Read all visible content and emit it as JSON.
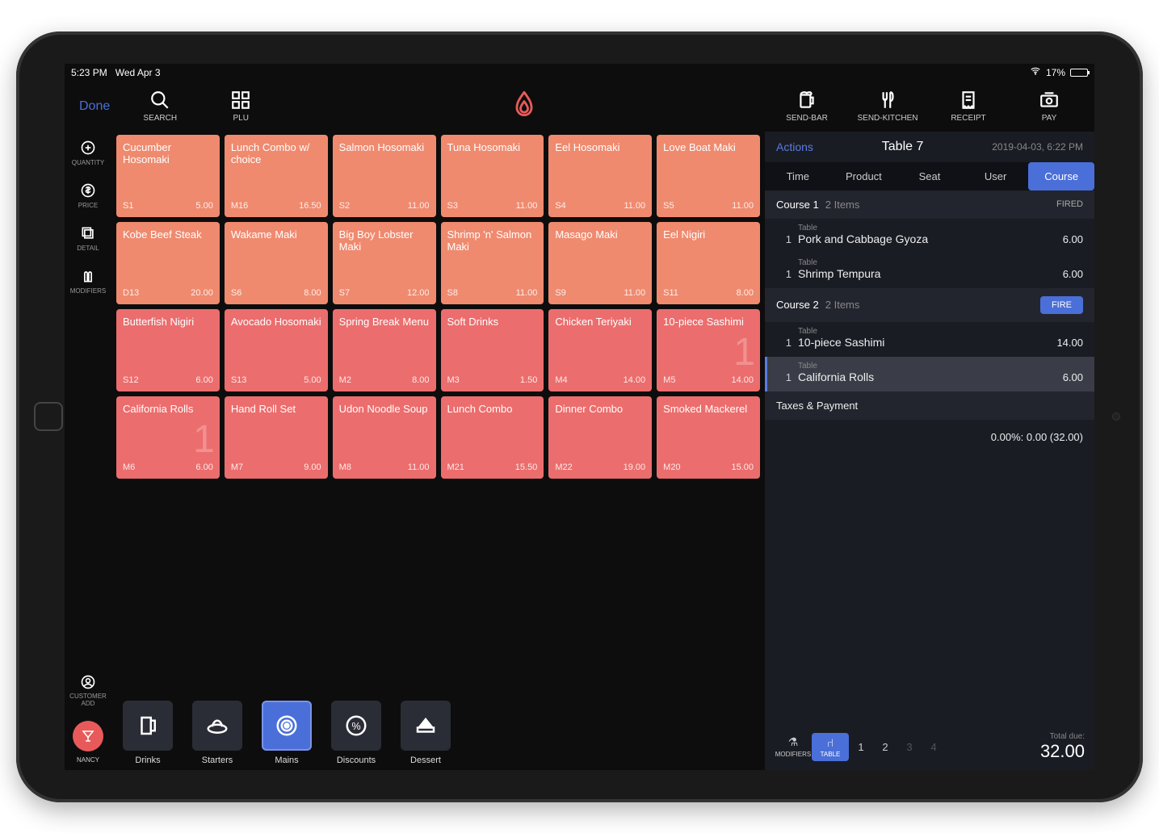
{
  "status": {
    "time": "5:23 PM",
    "date": "Wed Apr 3",
    "battery": "17%"
  },
  "topbar": {
    "done": "Done",
    "search": "SEARCH",
    "plu": "PLU",
    "sendbar": "SEND-BAR",
    "sendkitchen": "SEND-KITCHEN",
    "receipt": "RECEIPT",
    "pay": "PAY"
  },
  "rail": {
    "quantity": "QUANTITY",
    "price": "PRICE",
    "detail": "DETAIL",
    "modifiers": "MODIFIERS",
    "customer_add": "CUSTOMER ADD",
    "user": "NANCY"
  },
  "grid": [
    {
      "name": "Cucumber Hosomaki",
      "code": "S1",
      "price": "5.00",
      "color": "orange"
    },
    {
      "name": "Lunch Combo w/ choice",
      "code": "M16",
      "price": "16.50",
      "color": "orange"
    },
    {
      "name": "Salmon Hosomaki",
      "code": "S2",
      "price": "11.00",
      "color": "orange"
    },
    {
      "name": "Tuna Hosomaki",
      "code": "S3",
      "price": "11.00",
      "color": "orange"
    },
    {
      "name": "Eel Hosomaki",
      "code": "S4",
      "price": "11.00",
      "color": "orange"
    },
    {
      "name": "Love Boat Maki",
      "code": "S5",
      "price": "11.00",
      "color": "orange"
    },
    {
      "name": "Kobe Beef Steak",
      "code": "D13",
      "price": "20.00",
      "color": "orange"
    },
    {
      "name": "Wakame Maki",
      "code": "S6",
      "price": "8.00",
      "color": "orange"
    },
    {
      "name": "Big Boy Lobster Maki",
      "code": "S7",
      "price": "12.00",
      "color": "orange"
    },
    {
      "name": "Shrimp 'n' Salmon Maki",
      "code": "S8",
      "price": "11.00",
      "color": "orange"
    },
    {
      "name": "Masago Maki",
      "code": "S9",
      "price": "11.00",
      "color": "orange"
    },
    {
      "name": "Eel Nigiri",
      "code": "S11",
      "price": "8.00",
      "color": "orange"
    },
    {
      "name": "Butterfish Nigiri",
      "code": "S12",
      "price": "6.00",
      "color": "red"
    },
    {
      "name": "Avocado Hosomaki",
      "code": "S13",
      "price": "5.00",
      "color": "red"
    },
    {
      "name": "Spring Break Menu",
      "code": "M2",
      "price": "8.00",
      "color": "red"
    },
    {
      "name": "Soft Drinks",
      "code": "M3",
      "price": "1.50",
      "color": "red"
    },
    {
      "name": "Chicken Teriyaki",
      "code": "M4",
      "price": "14.00",
      "color": "red"
    },
    {
      "name": "10-piece Sashimi",
      "code": "M5",
      "price": "14.00",
      "color": "red",
      "badge": "1"
    },
    {
      "name": "California Rolls",
      "code": "M6",
      "price": "6.00",
      "color": "red",
      "badge": "1"
    },
    {
      "name": "Hand Roll Set",
      "code": "M7",
      "price": "9.00",
      "color": "red"
    },
    {
      "name": "Udon Noodle Soup",
      "code": "M8",
      "price": "11.00",
      "color": "red"
    },
    {
      "name": "Lunch Combo",
      "code": "M21",
      "price": "15.50",
      "color": "red"
    },
    {
      "name": "Dinner Combo",
      "code": "M22",
      "price": "19.00",
      "color": "red"
    },
    {
      "name": "Smoked Mackerel",
      "code": "M20",
      "price": "15.00",
      "color": "red"
    }
  ],
  "categories": [
    {
      "label": "Drinks"
    },
    {
      "label": "Starters"
    },
    {
      "label": "Mains",
      "active": true
    },
    {
      "label": "Discounts"
    },
    {
      "label": "Dessert"
    }
  ],
  "order": {
    "actions_label": "Actions",
    "title": "Table 7",
    "timestamp": "2019-04-03, 6:22 PM",
    "tabs": [
      "Time",
      "Product",
      "Seat",
      "User",
      "Course"
    ],
    "active_tab": "Course",
    "courses": [
      {
        "title": "Course 1",
        "count": "2 Items",
        "status": "FIRED",
        "lines": [
          {
            "qty": "1",
            "sub": "Table",
            "name": "Pork and Cabbage Gyoza",
            "price": "6.00"
          },
          {
            "qty": "1",
            "sub": "Table",
            "name": "Shrimp Tempura",
            "price": "6.00"
          }
        ]
      },
      {
        "title": "Course 2",
        "count": "2 Items",
        "fire": "FIRE",
        "lines": [
          {
            "qty": "1",
            "sub": "Table",
            "name": "10-piece Sashimi",
            "price": "14.00"
          },
          {
            "qty": "1",
            "sub": "Table",
            "name": "California Rolls",
            "price": "6.00",
            "selected": true
          }
        ]
      }
    ],
    "taxes_label": "Taxes & Payment",
    "tax_line": "0.00%: 0.00 (32.00)",
    "footer": {
      "modifiers": "MODIFIERS",
      "table": "TABLE",
      "seats": [
        "1",
        "2",
        "3",
        "4"
      ],
      "total_label": "Total due:",
      "total": "32.00"
    }
  }
}
